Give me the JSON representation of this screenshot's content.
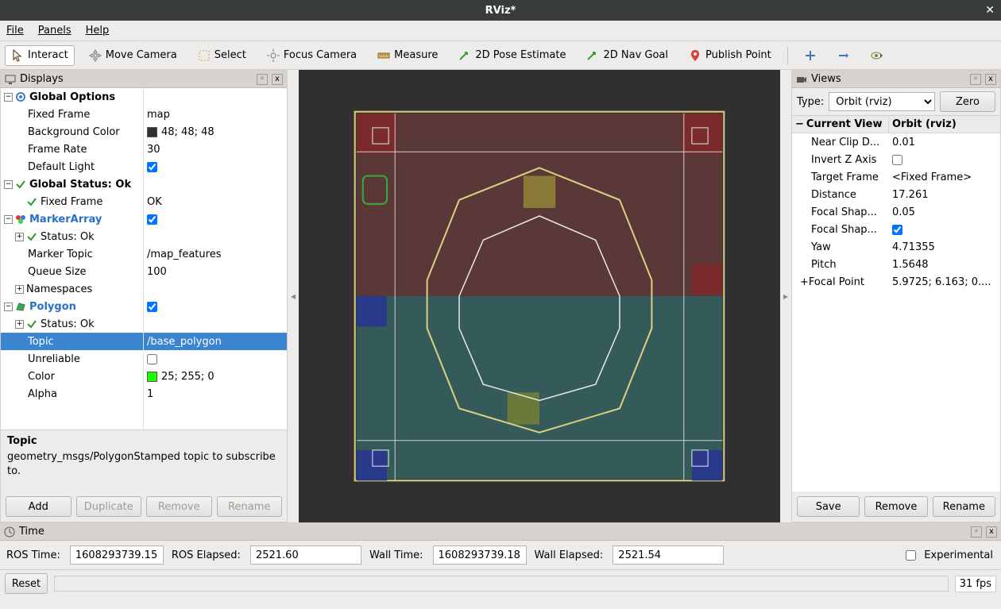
{
  "window": {
    "title": "RViz*"
  },
  "menu": {
    "file": "File",
    "panels": "Panels",
    "help": "Help"
  },
  "toolbar": {
    "interact": "Interact",
    "move_camera": "Move Camera",
    "select": "Select",
    "focus_camera": "Focus Camera",
    "measure": "Measure",
    "pose_estimate": "2D Pose Estimate",
    "nav_goal": "2D Nav Goal",
    "publish_point": "Publish Point"
  },
  "displays": {
    "title": "Displays",
    "global_options": {
      "label": "Global Options",
      "fixed_frame": {
        "label": "Fixed Frame",
        "value": "map"
      },
      "background_color": {
        "label": "Background Color",
        "value": "48; 48; 48",
        "hex": "#303030"
      },
      "frame_rate": {
        "label": "Frame Rate",
        "value": "30"
      },
      "default_light": {
        "label": "Default Light",
        "checked": true
      }
    },
    "global_status": {
      "label": "Global Status: Ok",
      "fixed_frame": {
        "label": "Fixed Frame",
        "value": "OK"
      }
    },
    "marker_array": {
      "label": "MarkerArray",
      "enabled": true,
      "status": "Status: Ok",
      "marker_topic": {
        "label": "Marker Topic",
        "value": "/map_features"
      },
      "queue_size": {
        "label": "Queue Size",
        "value": "100"
      },
      "namespaces": "Namespaces"
    },
    "polygon": {
      "label": "Polygon",
      "enabled": true,
      "status": "Status: Ok",
      "topic": {
        "label": "Topic",
        "value": "/base_polygon"
      },
      "unreliable": {
        "label": "Unreliable",
        "checked": false
      },
      "color": {
        "label": "Color",
        "value": "25; 255; 0",
        "hex": "#19ff00"
      },
      "alpha": {
        "label": "Alpha",
        "value": "1"
      }
    },
    "desc": {
      "title": "Topic",
      "body": "geometry_msgs/PolygonStamped topic to subscribe to."
    },
    "buttons": {
      "add": "Add",
      "duplicate": "Duplicate",
      "remove": "Remove",
      "rename": "Rename"
    }
  },
  "views": {
    "title": "Views",
    "type_label": "Type:",
    "type_value": "Orbit (rviz)",
    "zero": "Zero",
    "header": {
      "c1": "Current View",
      "c2": "Orbit (rviz)"
    },
    "rows": {
      "near_clip": {
        "label": "Near Clip D...",
        "value": "0.01"
      },
      "invert_z": {
        "label": "Invert Z Axis",
        "checked": false
      },
      "target_frame": {
        "label": "Target Frame",
        "value": "<Fixed Frame>"
      },
      "distance": {
        "label": "Distance",
        "value": "17.261"
      },
      "focal_shape_size": {
        "label": "Focal Shap...",
        "value": "0.05"
      },
      "focal_shape_fixed": {
        "label": "Focal Shap...",
        "checked": true
      },
      "yaw": {
        "label": "Yaw",
        "value": "4.71355"
      },
      "pitch": {
        "label": "Pitch",
        "value": "1.5648"
      },
      "focal_point": {
        "label": "Focal Point",
        "value": "5.9725; 6.163; 0...."
      }
    },
    "buttons": {
      "save": "Save",
      "remove": "Remove",
      "rename": "Rename"
    }
  },
  "time": {
    "title": "Time",
    "ros_time": {
      "label": "ROS Time:",
      "value": "1608293739.15"
    },
    "ros_elapsed": {
      "label": "ROS Elapsed:",
      "value": "2521.60"
    },
    "wall_time": {
      "label": "Wall Time:",
      "value": "1608293739.18"
    },
    "wall_elapsed": {
      "label": "Wall Elapsed:",
      "value": "2521.54"
    },
    "experimental": "Experimental"
  },
  "bottom": {
    "reset": "Reset",
    "fps": "31 fps"
  }
}
